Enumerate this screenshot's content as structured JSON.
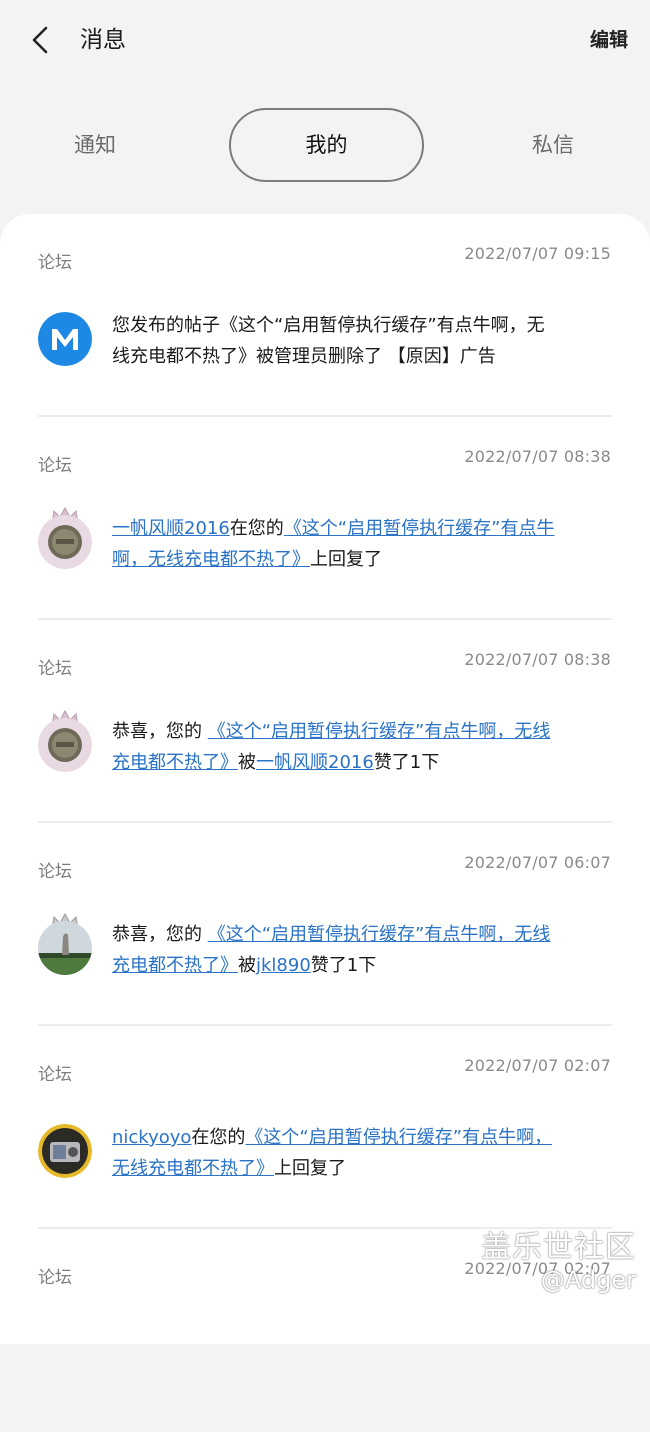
{
  "header": {
    "title": "消息",
    "edit_label": "编辑"
  },
  "tabs": [
    {
      "label": "通知",
      "selected": false
    },
    {
      "label": "我的",
      "selected": true
    },
    {
      "label": "私信",
      "selected": false
    }
  ],
  "messages": [
    {
      "category": "论坛",
      "time": "2022/07/07 09:15",
      "avatar": "m-logo",
      "line1": "您发布的帖子《这个“启用暂停执行缓存”有点牛啊，无",
      "line2": "线充电都不热了》被管理员删除了 【原因】广告"
    },
    {
      "category": "论坛",
      "time": "2022/07/07 08:38",
      "avatar": "coin-crown",
      "user": "一帆风顺2016",
      "mid": "在您的",
      "post_line1": "《这个“启用暂停执行缓存”有点牛",
      "post_line2": "啊，无线充电都不热了》",
      "tail": "上回复了"
    },
    {
      "category": "论坛",
      "time": "2022/07/07 08:38",
      "avatar": "coin-crown",
      "prefix": "恭喜，您的 ",
      "post_line1": "《这个“启用暂停执行缓存”有点牛啊，无线",
      "post_line2": "充电都不热了》",
      "mid": "被",
      "user": "一帆风顺2016",
      "tail": "赞了1下"
    },
    {
      "category": "论坛",
      "time": "2022/07/07 06:07",
      "avatar": "statue-crown",
      "prefix": "恭喜，您的 ",
      "post_line1": "《这个“启用暂停执行缓存”有点牛啊，无线",
      "post_line2": "充电都不热了》",
      "mid": "被",
      "user": "jkl890",
      "tail": "赞了1下"
    },
    {
      "category": "论坛",
      "time": "2022/07/07 02:07",
      "avatar": "camera",
      "user": "nickyoyo",
      "mid": "在您的",
      "post_line1": "《这个“启用暂停执行缓存”有点牛啊，",
      "post_line2": "无线充电都不热了》",
      "tail": "上回复了"
    },
    {
      "category": "论坛",
      "time": "2022/07/07 02:07"
    }
  ],
  "watermark": {
    "line1": "盖乐世社区",
    "line2": "@Adger"
  },
  "colors": {
    "link": "#2a73c7",
    "background": "#f3f3f3",
    "card": "#ffffff"
  }
}
